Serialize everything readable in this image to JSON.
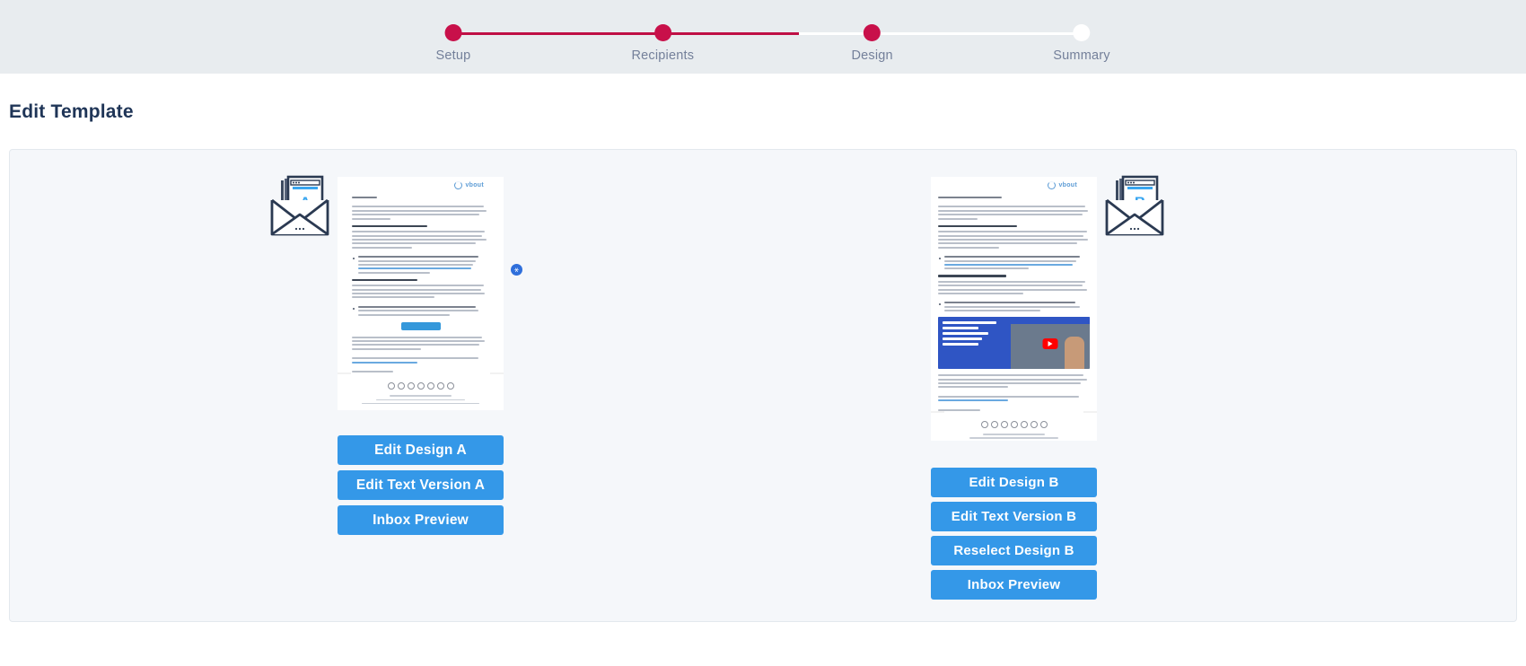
{
  "stepper": {
    "progress_percent": 55,
    "active_color": "#c8104a",
    "inactive_color": "#ffffff",
    "steps": [
      {
        "label": "Setup",
        "state": "complete"
      },
      {
        "label": "Recipients",
        "state": "complete"
      },
      {
        "label": "Design",
        "state": "current"
      },
      {
        "label": "Summary",
        "state": "upcoming"
      }
    ]
  },
  "page": {
    "title": "Edit Template",
    "title_color": "#1f3557",
    "panel_bg": "#f5f7fa"
  },
  "variants": [
    {
      "id": "a",
      "letter": "A",
      "icon_name": "envelope-letter-a-icon",
      "preview_name": "email-preview-a",
      "brand": "vbout",
      "has_video": false,
      "has_accessibility_badge": true,
      "accessibility_badge_icon": "accessibility-icon",
      "buttons": [
        {
          "label": "Edit Design A",
          "name": "edit-design-a-button"
        },
        {
          "label": "Edit Text Version A",
          "name": "edit-text-version-a-button"
        },
        {
          "label": "Inbox Preview",
          "name": "inbox-preview-a-button"
        }
      ]
    },
    {
      "id": "b",
      "letter": "B",
      "icon_name": "envelope-letter-b-icon",
      "preview_name": "email-preview-b",
      "brand": "vbout",
      "has_video": true,
      "video_title": "Google & Yahoo Email Requirements for 2024",
      "has_accessibility_badge": false,
      "buttons": [
        {
          "label": "Edit Design B",
          "name": "edit-design-b-button"
        },
        {
          "label": "Edit Text Version B",
          "name": "edit-text-version-b-button"
        },
        {
          "label": "Reselect Design B",
          "name": "reselect-design-b-button"
        },
        {
          "label": "Inbox Preview",
          "name": "inbox-preview-b-button"
        }
      ]
    }
  ],
  "colors": {
    "button_blue": "#3498e8",
    "stepper_red": "#c8104a",
    "header_bg": "#e8ecef",
    "icon_navy": "#2b3a52",
    "icon_blue": "#39a6f0"
  }
}
